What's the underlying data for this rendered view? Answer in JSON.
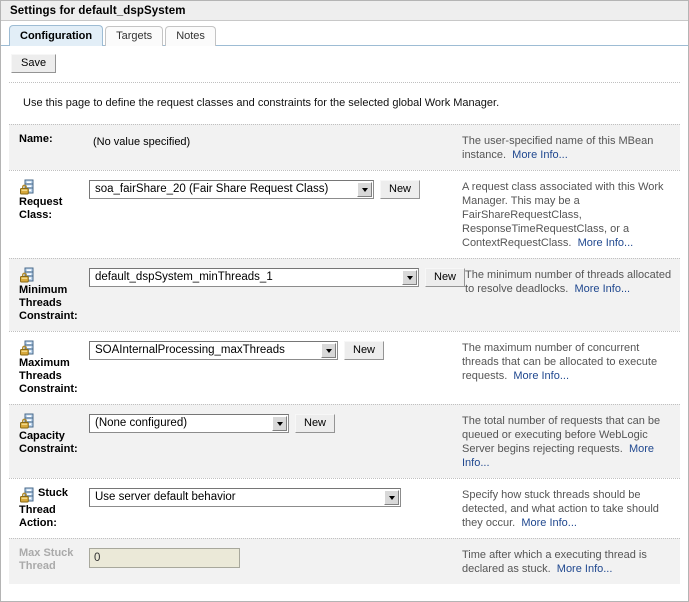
{
  "window": {
    "title": "Settings for default_dspSystem"
  },
  "tabs": [
    {
      "label": "Configuration",
      "active": true
    },
    {
      "label": "Targets",
      "active": false
    },
    {
      "label": "Notes",
      "active": false
    }
  ],
  "toolbar": {
    "save_label": "Save"
  },
  "intro": {
    "text": "Use this page to define the request classes and constraints for the selected global Work Manager."
  },
  "more_info_label": "More Info...",
  "new_button_label": "New",
  "rows": {
    "name": {
      "label": "Name:",
      "value": "(No value specified)",
      "help_text": "The user-specified name of this MBean instance.",
      "help_link": "More Info..."
    },
    "request_class": {
      "label": "Request Class:",
      "icon": "lock-server-icon",
      "value": "soa_fairShare_20 (Fair Share Request Class)",
      "new_label": "New",
      "help_text": "A request class associated with this Work Manager. This may be a FairShareRequestClass, ResponseTimeRequestClass, or a ContextRequestClass.",
      "help_link": "More Info..."
    },
    "min_threads": {
      "label": "Minimum Threads Constraint:",
      "icon": "lock-server-icon",
      "value": "default_dspSystem_minThreads_1",
      "new_label": "New",
      "help_text": "The minimum number of threads allocated to resolve deadlocks.",
      "help_link": "More Info..."
    },
    "max_threads": {
      "label": "Maximum Threads Constraint:",
      "icon": "lock-server-icon",
      "value": "SOAInternalProcessing_maxThreads",
      "new_label": "New",
      "help_text": "The maximum number of concurrent threads that can be allocated to execute requests.",
      "help_link": "More Info..."
    },
    "capacity": {
      "label": "Capacity Constraint:",
      "icon": "lock-server-icon",
      "value": "(None configured)",
      "new_label": "New",
      "help_text": "The total number of requests that can be queued or executing before WebLogic Server begins rejecting requests.",
      "help_link": "More Info..."
    },
    "stuck_thread_action": {
      "label_line1": "Stuck",
      "label_line2": "Thread",
      "label_line3": "Action:",
      "icon": "lock-server-icon",
      "value": "Use server default behavior",
      "help_text": "Specify how stuck threads should be detected, and what action to take should they occur.",
      "help_link": "More Info..."
    },
    "max_stuck_thread": {
      "label_line1": "Max Stuck",
      "label_line2": "Thread",
      "value": "0",
      "disabled": true,
      "help_text": "Time after which a executing thread is declared as stuck.",
      "help_link": "More Info..."
    }
  },
  "colors": {
    "tab_active_bg": "#e2eef7",
    "tab_border": "#9dbcd4",
    "row_shaded_bg": "#f2f2f2",
    "link": "#20488f",
    "help_text": "#555555",
    "disabled_text": "#aaaaaa",
    "disabled_input_bg": "#ebe9d8"
  }
}
